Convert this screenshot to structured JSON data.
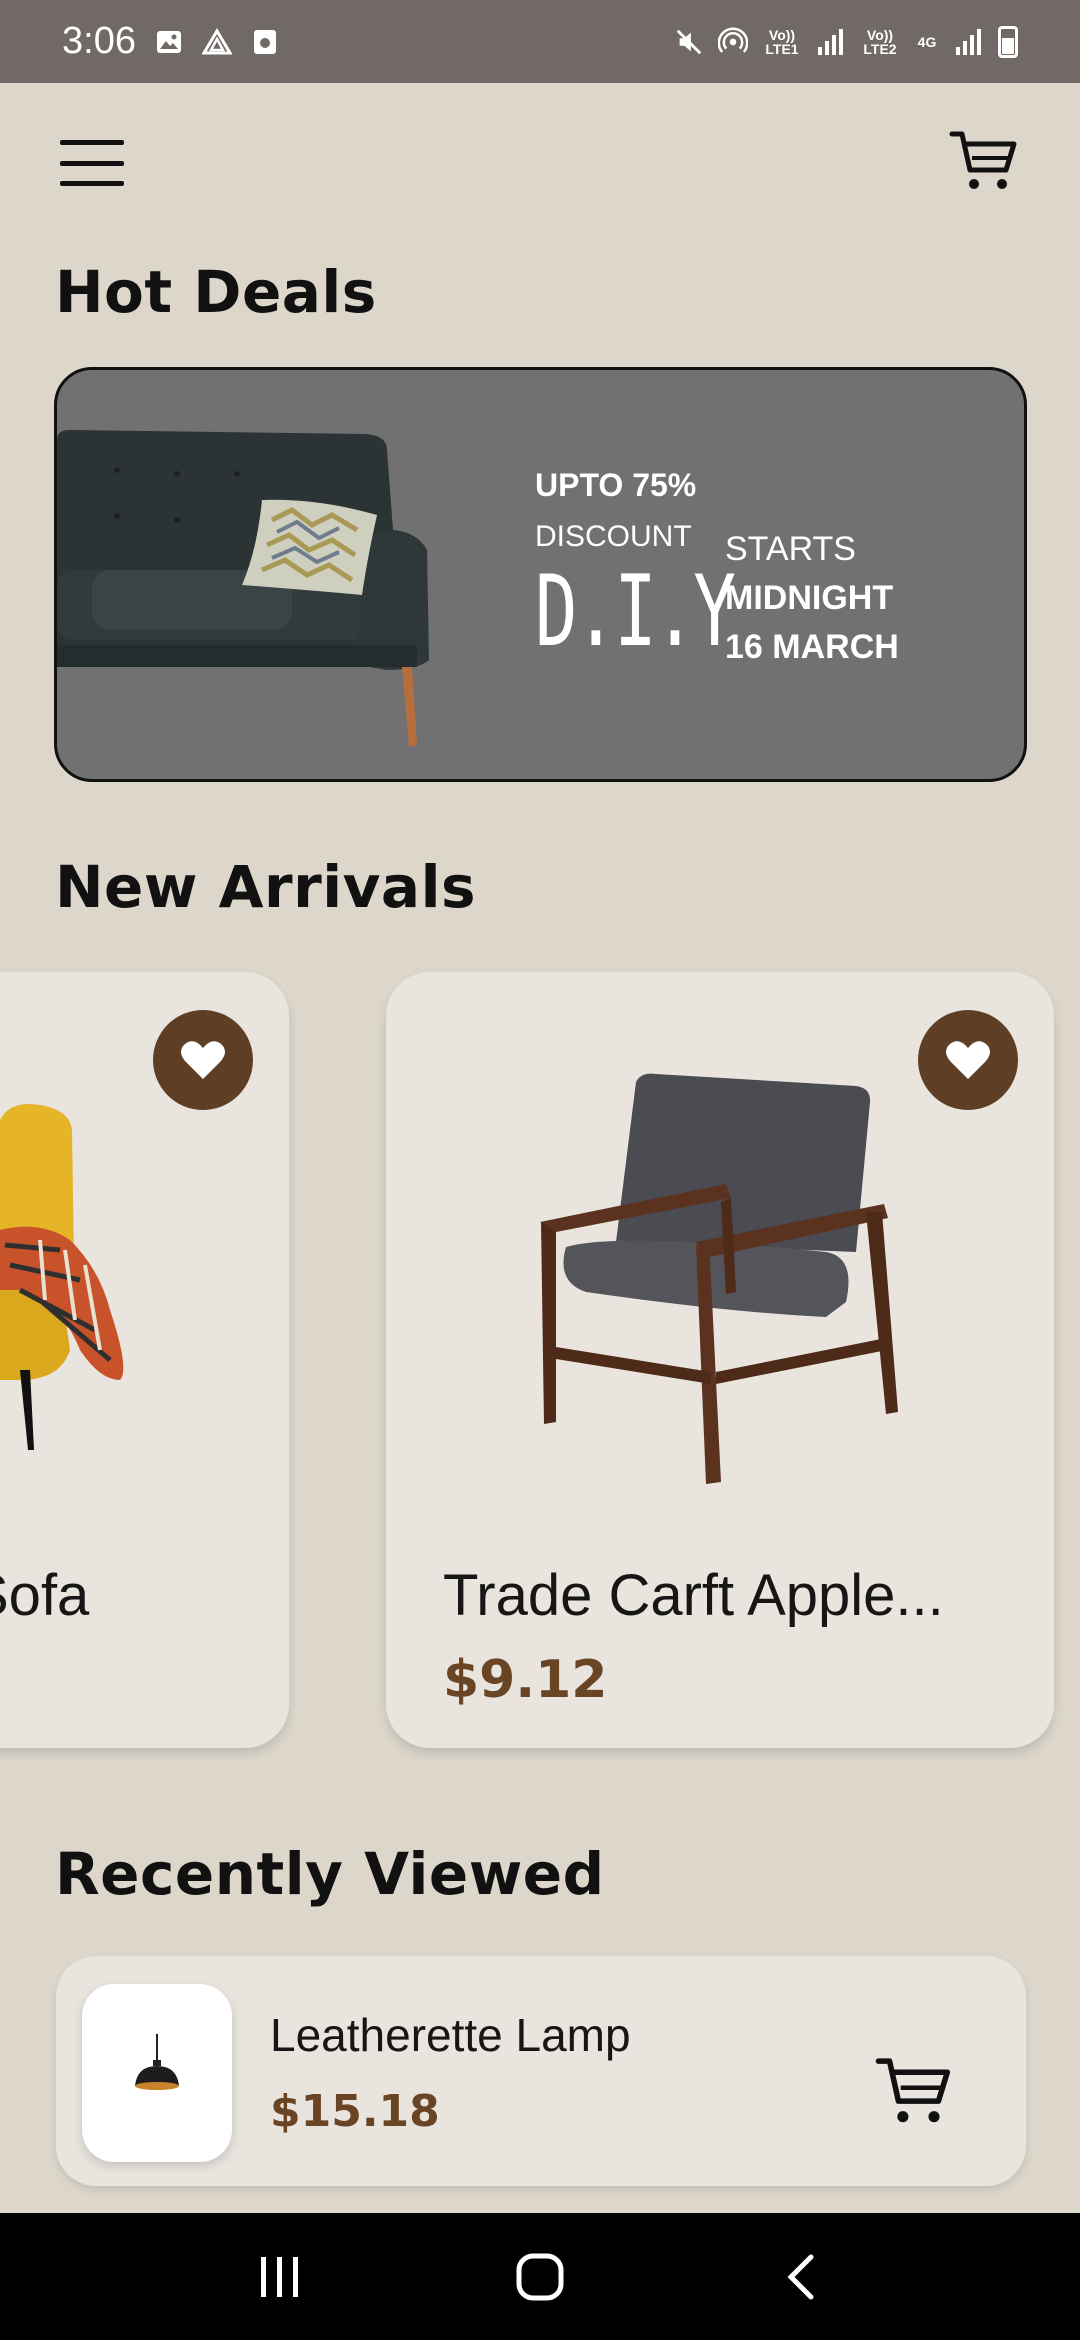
{
  "status_bar": {
    "time": "3:06",
    "icons": [
      "image-icon",
      "drive-icon",
      "app-icon",
      "mute-icon",
      "hotspot-icon",
      "signal-icon",
      "battery-icon"
    ],
    "lte1": "Vo)) LTE1",
    "lte2": "Vo)) LTE2",
    "net": "4G"
  },
  "header": {
    "menu_icon": "hamburger-menu-icon",
    "cart_icon": "cart-icon"
  },
  "hot_deals": {
    "title": "Hot Deals",
    "banner": {
      "line1": "UPTO 75%",
      "line2": "DISCOUNT",
      "brand": "D.I.Y",
      "starts": "STARTS",
      "when": "MIDNIGHT",
      "date": "16 MARCH"
    }
  },
  "new_arrivals": {
    "title": "New Arrivals",
    "items": [
      {
        "name": "Sofa",
        "price": ""
      },
      {
        "name": "Trade Carft Apple...",
        "price": "$9.12"
      }
    ]
  },
  "recently_viewed": {
    "title": "Recently Viewed",
    "items": [
      {
        "name": "Leatherette Lamp",
        "price": "$15.18"
      }
    ]
  },
  "colors": {
    "background": "#dcd6cb",
    "card": "#e9e4de",
    "accent_brown": "#5e3f25",
    "price_brown": "#694525",
    "banner_gray": "#717171"
  }
}
